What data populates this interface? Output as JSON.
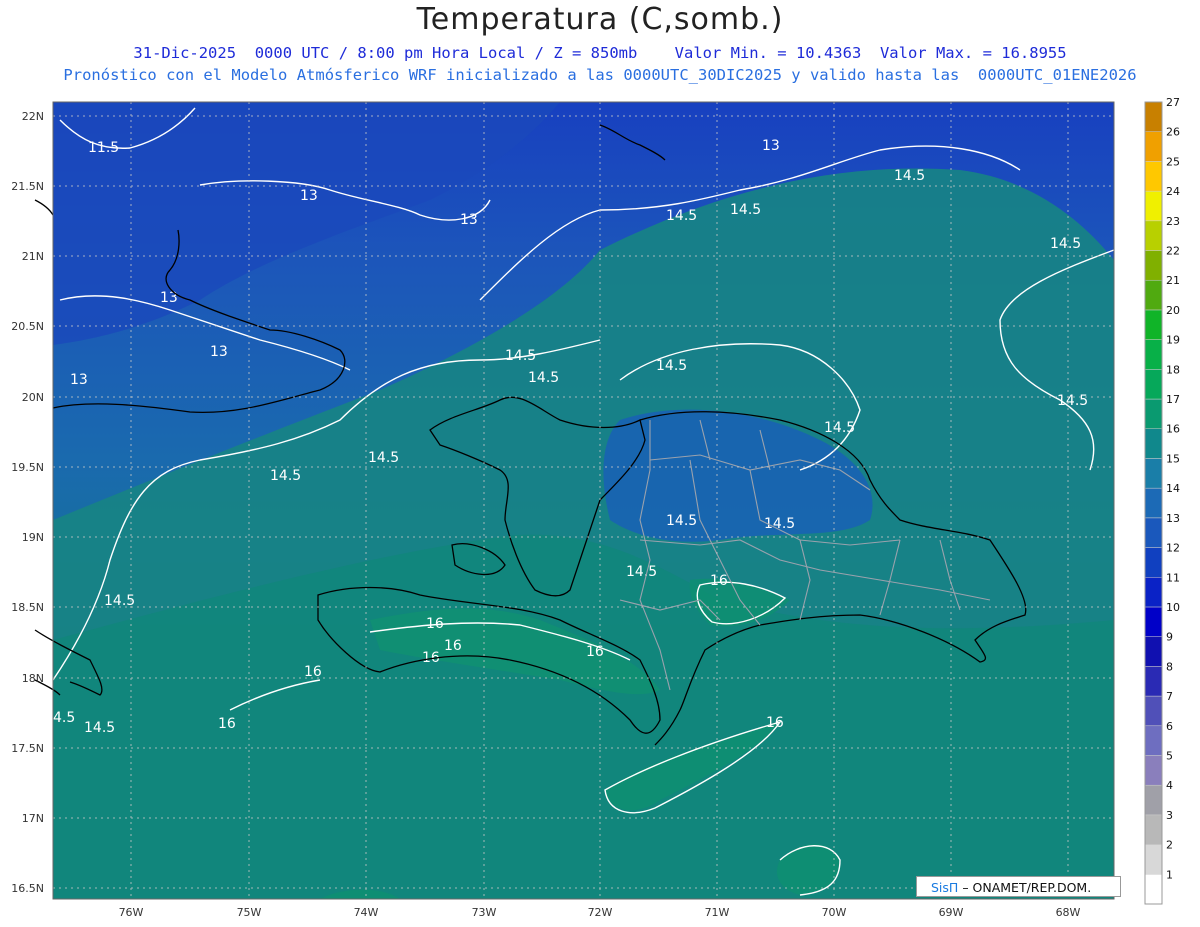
{
  "title": "Temperatura (C,somb.)",
  "subtitle_line1": "31-Dic-2025  0000 UTC / 8:00 pm Hora Local / Z = 850mb    Valor Min. = 10.4363  Valor Max. = 16.8955",
  "subtitle_line2": "Pronóstico con el Modelo Atmósferico WRF inicializado a las 0000UTC_30DIC2025 y valido hasta las  0000UTC_01ENE2026",
  "credit": {
    "brand": "SisΠ",
    "text": "– ONAMET/REP.DOM."
  },
  "lat_labels": [
    "22N",
    "21.5N",
    "21N",
    "20.5N",
    "20N",
    "19.5N",
    "19N",
    "18.5N",
    "18N",
    "17.5N",
    "17N",
    "16.5N"
  ],
  "lon_labels": [
    "76W",
    "75W",
    "74W",
    "73W",
    "72W",
    "71W",
    "70W",
    "69W",
    "68W"
  ],
  "colorbar": {
    "levels": [
      "1",
      "2",
      "3",
      "4",
      "5",
      "6",
      "7",
      "8",
      "9",
      "10",
      "11",
      "12",
      "13",
      "14",
      "15",
      "16",
      "17",
      "18",
      "19",
      "20",
      "21",
      "22",
      "23",
      "24",
      "25",
      "26",
      "27"
    ],
    "colors": [
      "#ffffff",
      "#d8d8d8",
      "#b8b8b8",
      "#a0a0a8",
      "#8a7fbc",
      "#6e6ec0",
      "#5050b8",
      "#2a2ab4",
      "#1010b0",
      "#0000c8",
      "#0a22c6",
      "#1040c0",
      "#1a58bc",
      "#1c6ab6",
      "#1a7ea8",
      "#10888c",
      "#0a9a70",
      "#06a85a",
      "#08b048",
      "#10b428",
      "#50aa10",
      "#80b000",
      "#b8d000",
      "#f0f000",
      "#ffc800",
      "#f0a000",
      "#c88000"
    ],
    "top_value": "27"
  },
  "contours": [
    {
      "value": "11.5"
    },
    {
      "value": "13"
    },
    {
      "value": "14.5"
    },
    {
      "value": "16"
    }
  ],
  "stats": {
    "min": 10.4363,
    "max": 16.8955,
    "level_mb": 850
  }
}
